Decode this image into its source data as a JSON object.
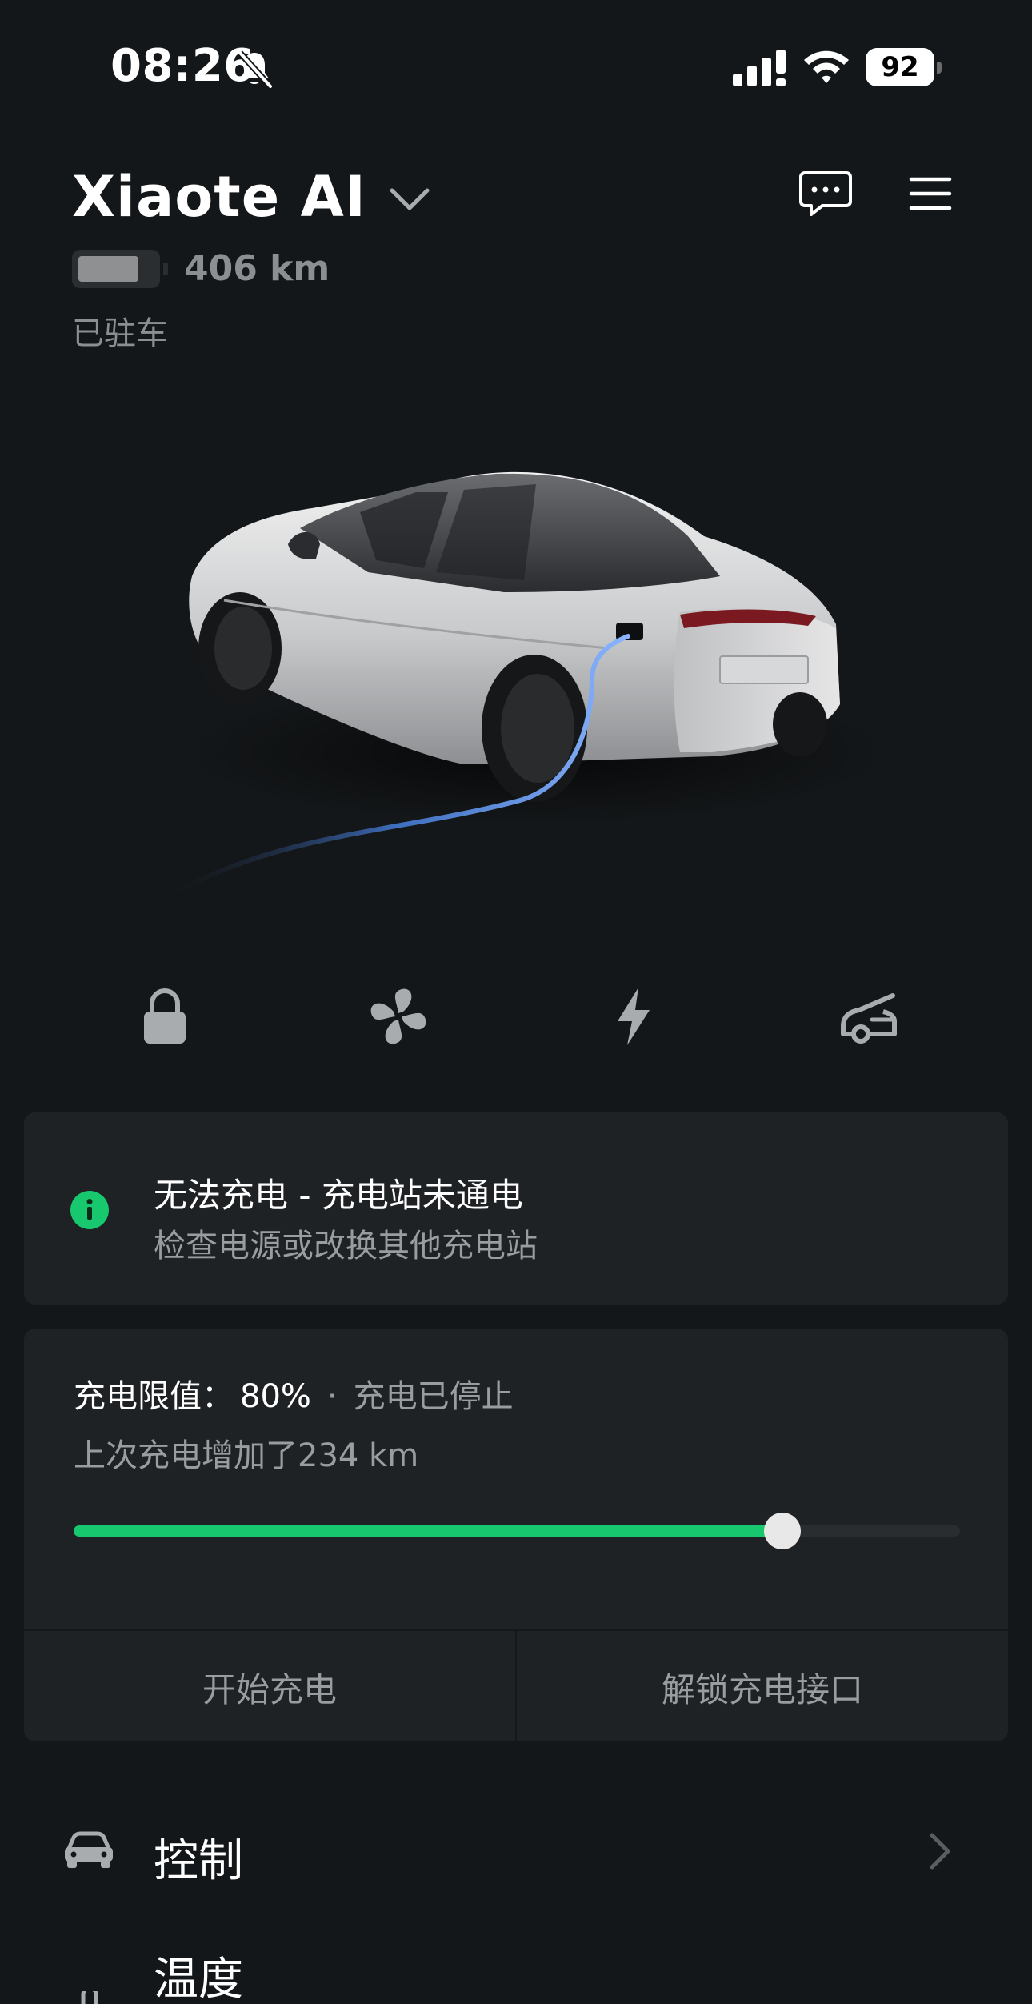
{
  "status_bar": {
    "time": "08:26",
    "battery_percent": "92"
  },
  "header": {
    "vehicle_name": "Xiaote AI",
    "range": "406 km",
    "park_status": "已驻车",
    "battery_level_fraction": 0.8
  },
  "quick_actions": [
    {
      "icon": "lock-icon"
    },
    {
      "icon": "fan-icon"
    },
    {
      "icon": "lightning-icon"
    },
    {
      "icon": "frunk-open-icon"
    }
  ],
  "alert": {
    "title": "无法充电 - 充电站未通电",
    "subtitle": "检查电源或改换其他充电站",
    "icon": "info-icon",
    "color": "#17c86e"
  },
  "charging": {
    "limit_label": "充电限值：",
    "limit_value": "80%",
    "separator": "·",
    "status": "充电已停止",
    "added": "上次充电增加了234 km",
    "limit_fraction": 0.8,
    "accent_color": "#17c86e",
    "start_label": "开始充电",
    "unlock_port_label": "解锁充电接口"
  },
  "menu": [
    {
      "label": "控制",
      "icon": "car-icon"
    },
    {
      "label": "温度",
      "icon": "temperature-icon"
    }
  ]
}
